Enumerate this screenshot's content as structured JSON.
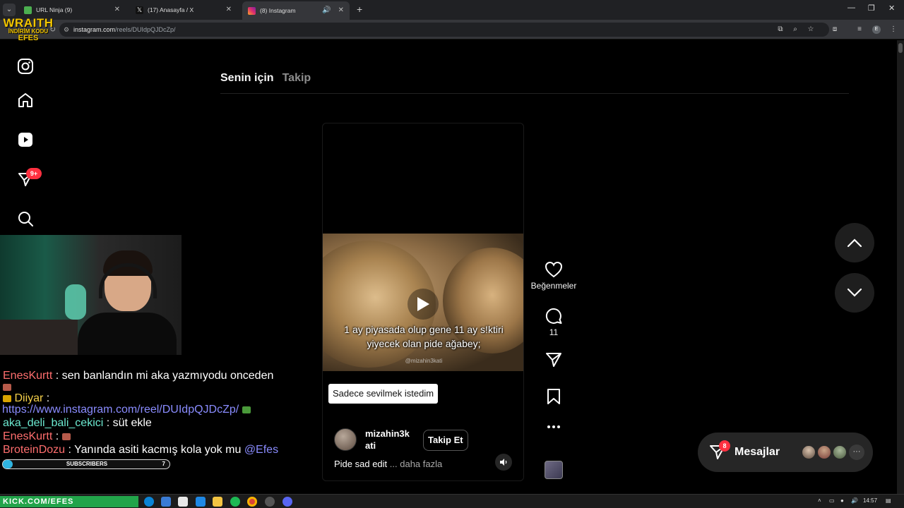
{
  "browser": {
    "tabs": [
      {
        "label": "URL Ninja (9)",
        "favicon_color": "#4caf50",
        "active": false
      },
      {
        "label": "(17) Anasayfa / X",
        "favicon_color": "#000000",
        "active": false
      },
      {
        "label": "(8) Instagram",
        "favicon_color": "#e1306c",
        "active": true
      }
    ],
    "new_tab": "+",
    "url_host": "instagram.com",
    "url_path": "/reels/DUIdpQJDcZp/",
    "profile_letter": "E"
  },
  "overlay_logo": {
    "line1": "WRAITH",
    "line2": "İNDİRİM KODU",
    "line3": "EFES"
  },
  "sidebar": {
    "notification_badge": "9+"
  },
  "feed_tabs": {
    "active": "Senin için",
    "inactive": "Takip"
  },
  "reel": {
    "caption_overlay_line1": "1 ay piyasada olup gene 11 ay s!ktiri",
    "caption_overlay_line2": "yiyecek olan pide ağabey;",
    "watermark": "@mizahin3kati",
    "chip_text": "Sadece sevilmek istedim",
    "username_line1": "mizahin3k",
    "username_line2": "ati",
    "follow_label": "Takip Et",
    "description": "Pide sad edit",
    "more_label": "... daha fazla"
  },
  "actions": {
    "like_label": "Beğenmeler",
    "comment_count": "11"
  },
  "messages": {
    "label": "Mesajlar",
    "badge": "8",
    "more": "···"
  },
  "chat": {
    "line1_user": "EnesKurtt",
    "line1_text": ": sen banlandın mi aka yazmıyodu onceden",
    "line2_user": "Diiyar",
    "line2_text": ":",
    "line3_link": "https://www.instagram.com/reel/DUIdpQJDcZp/",
    "line4_user": "aka_deli_bali_cekici",
    "line4_text": ": süt ekle",
    "line5_user": "EnesKurtt",
    "line5_text": ":",
    "line6_user": "BroteinDozu",
    "line6_text": ": Yanında asiti kacmış kola yok mu",
    "line6_mention": "@Efes",
    "subscribers_label": "SUBSCRIBERS",
    "subscribers_count": "7",
    "subscribers_progress": 0.05
  },
  "taskbar": {
    "brand": "KICK.COM/EFES",
    "time": "14:57"
  },
  "colors": {
    "accent_red": "#ff3040",
    "background": "#000000",
    "subscriber_fill": "#2fb4e0"
  }
}
